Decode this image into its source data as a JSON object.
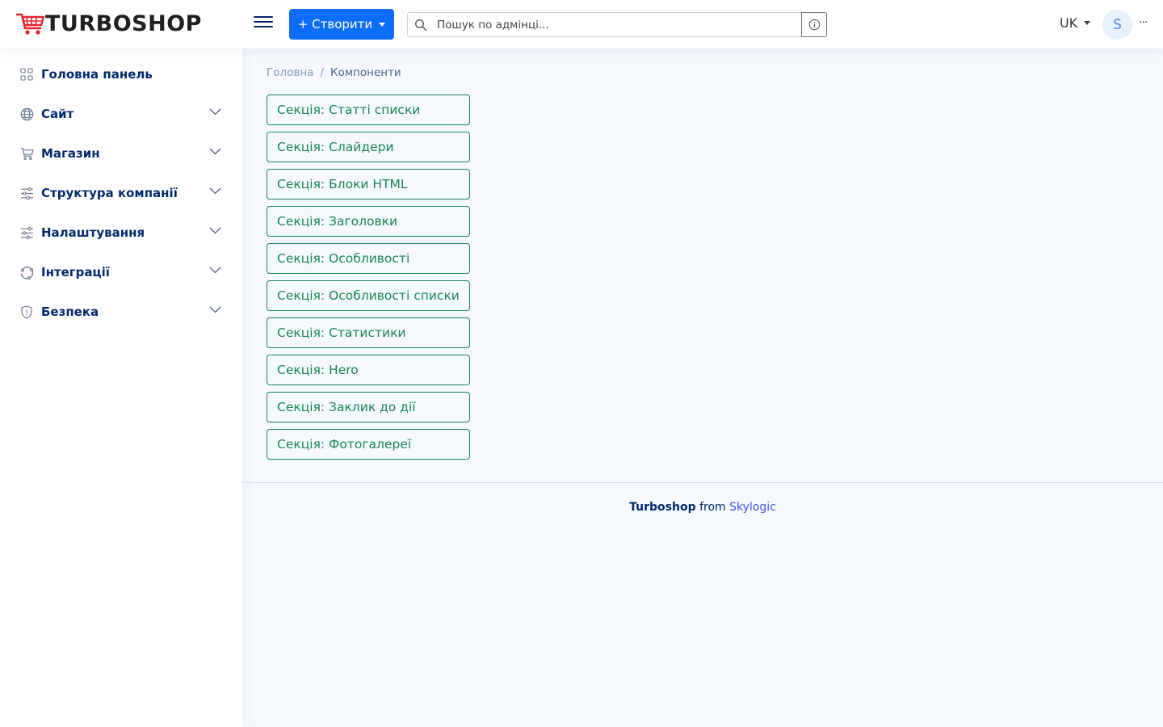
{
  "header": {
    "logo_text": "TURBOSHOP",
    "create_label": "+ Створити",
    "search_placeholder": "Пошук по адмінці...",
    "language": "UK",
    "avatar_initial": "S",
    "more_label": "···"
  },
  "sidebar": {
    "items": [
      {
        "label": "Головна панель",
        "icon": "grid-icon",
        "expandable": false
      },
      {
        "label": "Сайт",
        "icon": "globe-icon",
        "expandable": true
      },
      {
        "label": "Магазин",
        "icon": "cart-icon",
        "expandable": true
      },
      {
        "label": "Структура компанії",
        "icon": "sliders-icon",
        "expandable": true
      },
      {
        "label": "Налаштування",
        "icon": "sliders-icon",
        "expandable": true
      },
      {
        "label": "Інтеграції",
        "icon": "integration-icon",
        "expandable": true
      },
      {
        "label": "Безпека",
        "icon": "shield-icon",
        "expandable": true
      }
    ]
  },
  "breadcrumb": {
    "home": "Головна",
    "separator": "/",
    "current": "Компоненти"
  },
  "sections": [
    "Секція: Статті списки",
    "Секція: Слайдери",
    "Секція: Блоки HTML",
    "Секція: Заголовки",
    "Секція: Особливості",
    "Секція: Особливості списки",
    "Секція: Статистики",
    "Секція: Hero",
    "Секція: Заклик до дії",
    "Секція: Фотогалереї"
  ],
  "footer": {
    "brand": "Turboshop",
    "from": "from",
    "company": "Skylogic"
  },
  "colors": {
    "primary": "#0d6efd",
    "nav_text": "#012970",
    "section_border": "#198754",
    "background": "#f5f8fd",
    "logo_cart": "#e0262f"
  }
}
